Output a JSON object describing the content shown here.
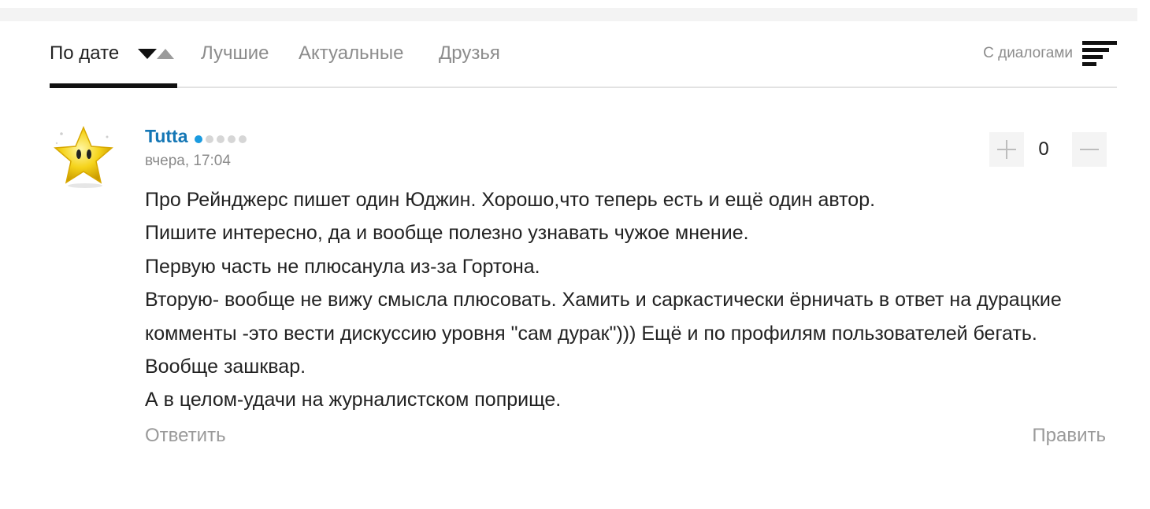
{
  "tabs": {
    "date": "По дате",
    "best": "Лучшие",
    "actual": "Актуальные",
    "friends": "Друзья",
    "active": "date"
  },
  "dialogs": {
    "label": "С диалогами"
  },
  "comment": {
    "author": "Tutta",
    "author_rating_level": 1,
    "author_rating_max": 5,
    "timestamp": "вчера, 17:04",
    "score": "0",
    "lines": [
      "Про Рейнджерс пишет один Юджин. Хорошо,что теперь есть и ещё один автор.",
      "Пишите интересно, да и вообще полезно узнавать чужое мнение.",
      "Первую часть не плюсанула из-за Гортона.",
      "Вторую- вообще не вижу смысла плюсовать. Хамить и саркастически ёрничать в ответ на дурацкие комменты -это вести дискуссию уровня \"сам дурак\"))) Ещё и по профилям пользователей бегать. Вообще зашквар.",
      "А в целом-удачи на журналистском поприще."
    ],
    "reply_label": "Ответить",
    "edit_label": "Править"
  },
  "colors": {
    "author": "#1577b5",
    "rating_on": "#1a9be0",
    "muted": "#8c8c8c",
    "accent": "#111111"
  },
  "icons": {
    "sort": "sort-desc-asc-icon",
    "dialogs": "dialogs-lines-icon",
    "avatar": "star-avatar",
    "plus": "plus-icon",
    "minus": "minus-icon"
  }
}
